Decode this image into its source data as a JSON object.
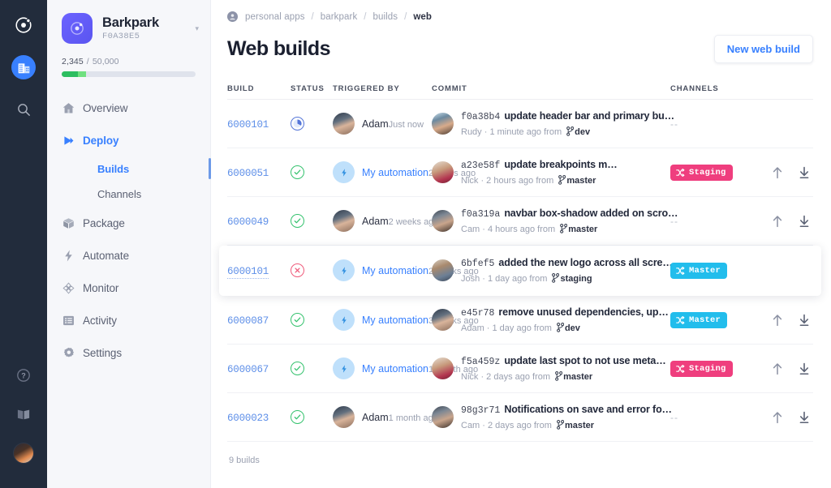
{
  "rail": {
    "items": [
      {
        "name": "ionic-logo-icon",
        "label": "Ionic"
      },
      {
        "name": "organization-icon",
        "label": "Organization"
      },
      {
        "name": "search-icon",
        "label": "Search"
      }
    ],
    "bottom": [
      {
        "name": "help-icon",
        "label": "Help"
      },
      {
        "name": "docs-book-icon",
        "label": "Docs"
      },
      {
        "name": "user-avatar",
        "label": "Account"
      }
    ]
  },
  "sidebar": {
    "project": {
      "name": "Barkpark",
      "id": "F0A38E5",
      "caret": "▾"
    },
    "usage": {
      "used": "2,345",
      "separator": "/",
      "total": "50,000",
      "percent_a": 12,
      "percent_b": 6
    },
    "nav": [
      {
        "label": "Overview",
        "icon": "home-icon"
      },
      {
        "label": "Deploy",
        "icon": "play-icon"
      },
      {
        "label": "Builds",
        "icon": ""
      },
      {
        "label": "Channels",
        "icon": ""
      },
      {
        "label": "Package",
        "icon": "box-icon"
      },
      {
        "label": "Automate",
        "icon": "bolt-icon"
      },
      {
        "label": "Monitor",
        "icon": "monitor-icon"
      },
      {
        "label": "Activity",
        "icon": "list-icon"
      },
      {
        "label": "Settings",
        "icon": "gear-icon"
      }
    ]
  },
  "breadcrumb": {
    "items": [
      "personal apps",
      "barkpark",
      "builds",
      "web"
    ],
    "separator": "/"
  },
  "header": {
    "title": "Web builds",
    "new_build_label": "New web build"
  },
  "table": {
    "columns": [
      "BUILD",
      "STATUS",
      "TRIGGERED BY",
      "COMMIT",
      "CHANNELS"
    ],
    "rows": [
      {
        "build": "6000101",
        "status": "running",
        "trigger_name": "Adam",
        "trigger_when": "Just now",
        "trigger_type": "user",
        "sha": "f0a38b4",
        "message": "update header bar and primary bu…",
        "author": "Rudy",
        "commit_when": "1 minute ago from",
        "branch": "dev",
        "channel": null,
        "channel_dash": "--",
        "actions": false,
        "selected": false
      },
      {
        "build": "6000051",
        "status": "ok",
        "trigger_name": "My automation",
        "trigger_when": "2 hours ago",
        "trigger_type": "automation",
        "sha": "a23e58f",
        "message": "update breakpoints m…",
        "author": "Nick",
        "commit_when": "2 hours ago from",
        "branch": "master",
        "channel": "Staging",
        "channel_kind": "staging",
        "actions": true,
        "selected": false
      },
      {
        "build": "6000049",
        "status": "ok",
        "trigger_name": "Adam",
        "trigger_when": "2 weeks ago",
        "trigger_type": "user",
        "sha": "f0a319a",
        "message": "navbar box-shadow added on scro…",
        "author": "Cam",
        "commit_when": "4 hours ago from",
        "branch": "master",
        "channel": null,
        "channel_dash": "--",
        "actions": true,
        "selected": false
      },
      {
        "build": "6000101",
        "status": "error",
        "trigger_name": "My automation",
        "trigger_when": "2 weeks ago",
        "trigger_type": "automation",
        "sha": "6bfef5",
        "message": "added the new logo across all scre…",
        "author": "Josh",
        "commit_when": "1 day ago from",
        "branch": "staging",
        "channel": "Master",
        "channel_kind": "master",
        "actions": false,
        "selected": true
      },
      {
        "build": "6000087",
        "status": "ok",
        "trigger_name": "My automation",
        "trigger_when": "3 weeks ago",
        "trigger_type": "automation",
        "sha": "e45r78",
        "message": "remove unused dependencies, up…",
        "author": "Adam",
        "commit_when": "1 day ago from",
        "branch": "dev",
        "channel": "Master",
        "channel_kind": "master",
        "actions": true,
        "selected": false
      },
      {
        "build": "6000067",
        "status": "ok",
        "trigger_name": "My automation",
        "trigger_when": "1 month ago",
        "trigger_type": "automation",
        "sha": "f5a459z",
        "message": "update last spot to not use meta…",
        "author": "Nick",
        "commit_when": "2 days ago from",
        "branch": "master",
        "channel": "Staging",
        "channel_kind": "staging",
        "actions": true,
        "selected": false
      },
      {
        "build": "6000023",
        "status": "ok",
        "trigger_name": "Adam",
        "trigger_when": "1 month ago",
        "trigger_type": "user",
        "sha": "98g3r71",
        "message": "Notifications on save and error fo…",
        "author": "Cam",
        "commit_when": "2 days ago from",
        "branch": "master",
        "channel": null,
        "channel_dash": "--",
        "actions": true,
        "selected": false
      }
    ],
    "footer": "9 builds"
  },
  "colors": {
    "accent": "#3880ff",
    "staging": "#ef3e7e",
    "master": "#22bdec",
    "ok": "#34c26d",
    "error": "#ef5a7a",
    "running": "#5576d8",
    "rail_bg": "#222c3c",
    "sidebar_bg": "#f6f7fa"
  }
}
